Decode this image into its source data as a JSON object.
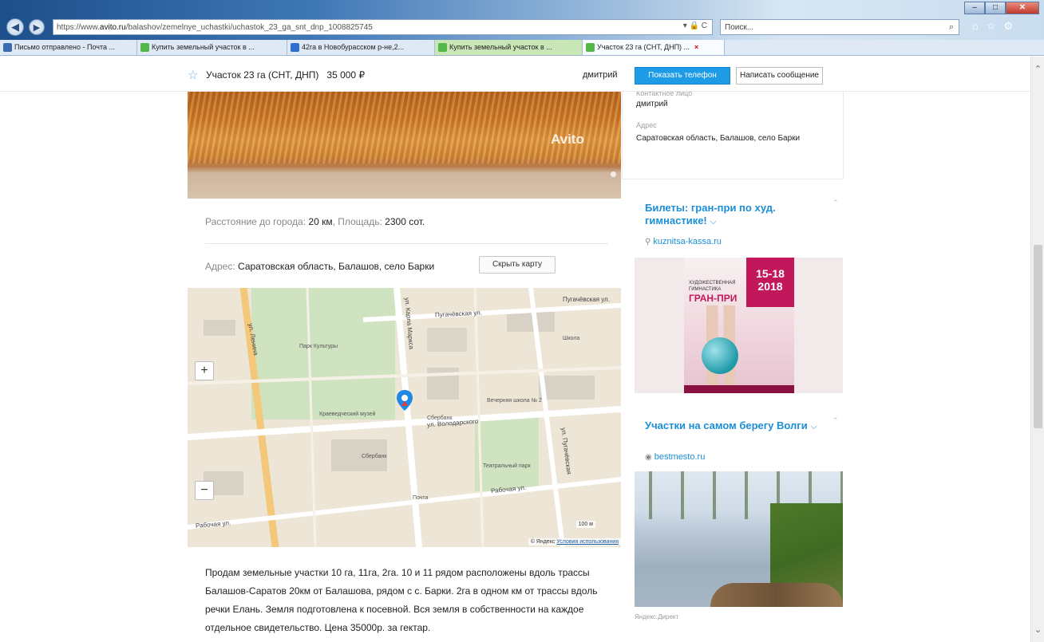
{
  "browser": {
    "window_controls": [
      "–",
      "□",
      "✕"
    ],
    "address": {
      "url_prefix": "https://www.",
      "url_domain": "avito.ru",
      "url_path": "/balashov/zemelnye_uchastki/uchastok_23_ga_snt_dnp_1008825745",
      "icons": "▾ 🔒 C"
    },
    "search_placeholder": "Поиск...",
    "tabs": [
      {
        "label": "Письмо отправлено - Почта ...",
        "color": "#3b6ab0"
      },
      {
        "label": "Купить земельный участок в ...",
        "color": "#53b848"
      },
      {
        "label": "42га в Новобурасском р-не,2...",
        "color": "#2c6fd0"
      },
      {
        "label": "Купить земельный участок в ...",
        "color": "#53b848"
      },
      {
        "label": "Участок 23 га (СНТ, ДНП) ...",
        "color": "#53b848"
      }
    ]
  },
  "header": {
    "title": "Участок 23 га (СНТ, ДНП)",
    "price": "35 000 ₽",
    "seller": "дмитрий",
    "phone_button": "Показать телефон",
    "message_button": "Написать сообщение"
  },
  "photo": {
    "watermark": "Avito"
  },
  "params": {
    "distance_label": "Расстояние до города:",
    "distance_value": "20 км",
    "area_label": "Площадь:",
    "area_value": "2300 сот."
  },
  "address": {
    "label": "Адрес:",
    "value": "Саратовская область, Балашов, село Барки",
    "hide_map_button": "Скрыть карту"
  },
  "map": {
    "streets": [
      "ул. Ленина",
      "ул. Карла Маркса",
      "ул. Володарского",
      "Пугачёвская ул.",
      "ул. Пугачёвская",
      "Рабочая ул.",
      "Рабочая ул.",
      "Пугачёвская ул."
    ],
    "pois": [
      "Сбербанк",
      "Краеведческий музей",
      "Парк Культуры",
      "Школа",
      "Вечерняя школа № 2",
      "Сбербанк",
      "Театральный парк",
      "Почта"
    ],
    "zoom_in": "+",
    "zoom_out": "−",
    "scale": "100 м",
    "attribution": "© Яндекс",
    "terms": "Условия использования"
  },
  "description": "Продам земельные участки 10 га, 11га, 2га. 10 и 11 рядом расположены вдоль трассы Балашов-Саратов 20км от Балашова, рядом с с. Барки. 2га в одном км от трассы вдоль речки Елань. Земля подготовлена к посевной. Вся земля в собственности на каждое отдельное свидетельство. Цена 35000р. за гектар.",
  "contact": {
    "name_label": "Контактное лицо",
    "name": "дмитрий",
    "address_label": "Адрес",
    "address": "Саратовская область, Балашов, село Барки"
  },
  "ads": [
    {
      "title": "Билеты: гран-при по худ. гимнастике!",
      "domain": "kuznitsa-kassa.ru",
      "poster_title": "ХУДОЖЕСТВЕННАЯ ГИМНАСТИКА",
      "poster_title_big": "ГРАН-ПРИ",
      "poster_dates": "15-18 2018"
    },
    {
      "title": "Участки на самом берегу Волги",
      "domain": "bestmesto.ru"
    }
  ],
  "yandex_direct": "Яндекс.Директ"
}
